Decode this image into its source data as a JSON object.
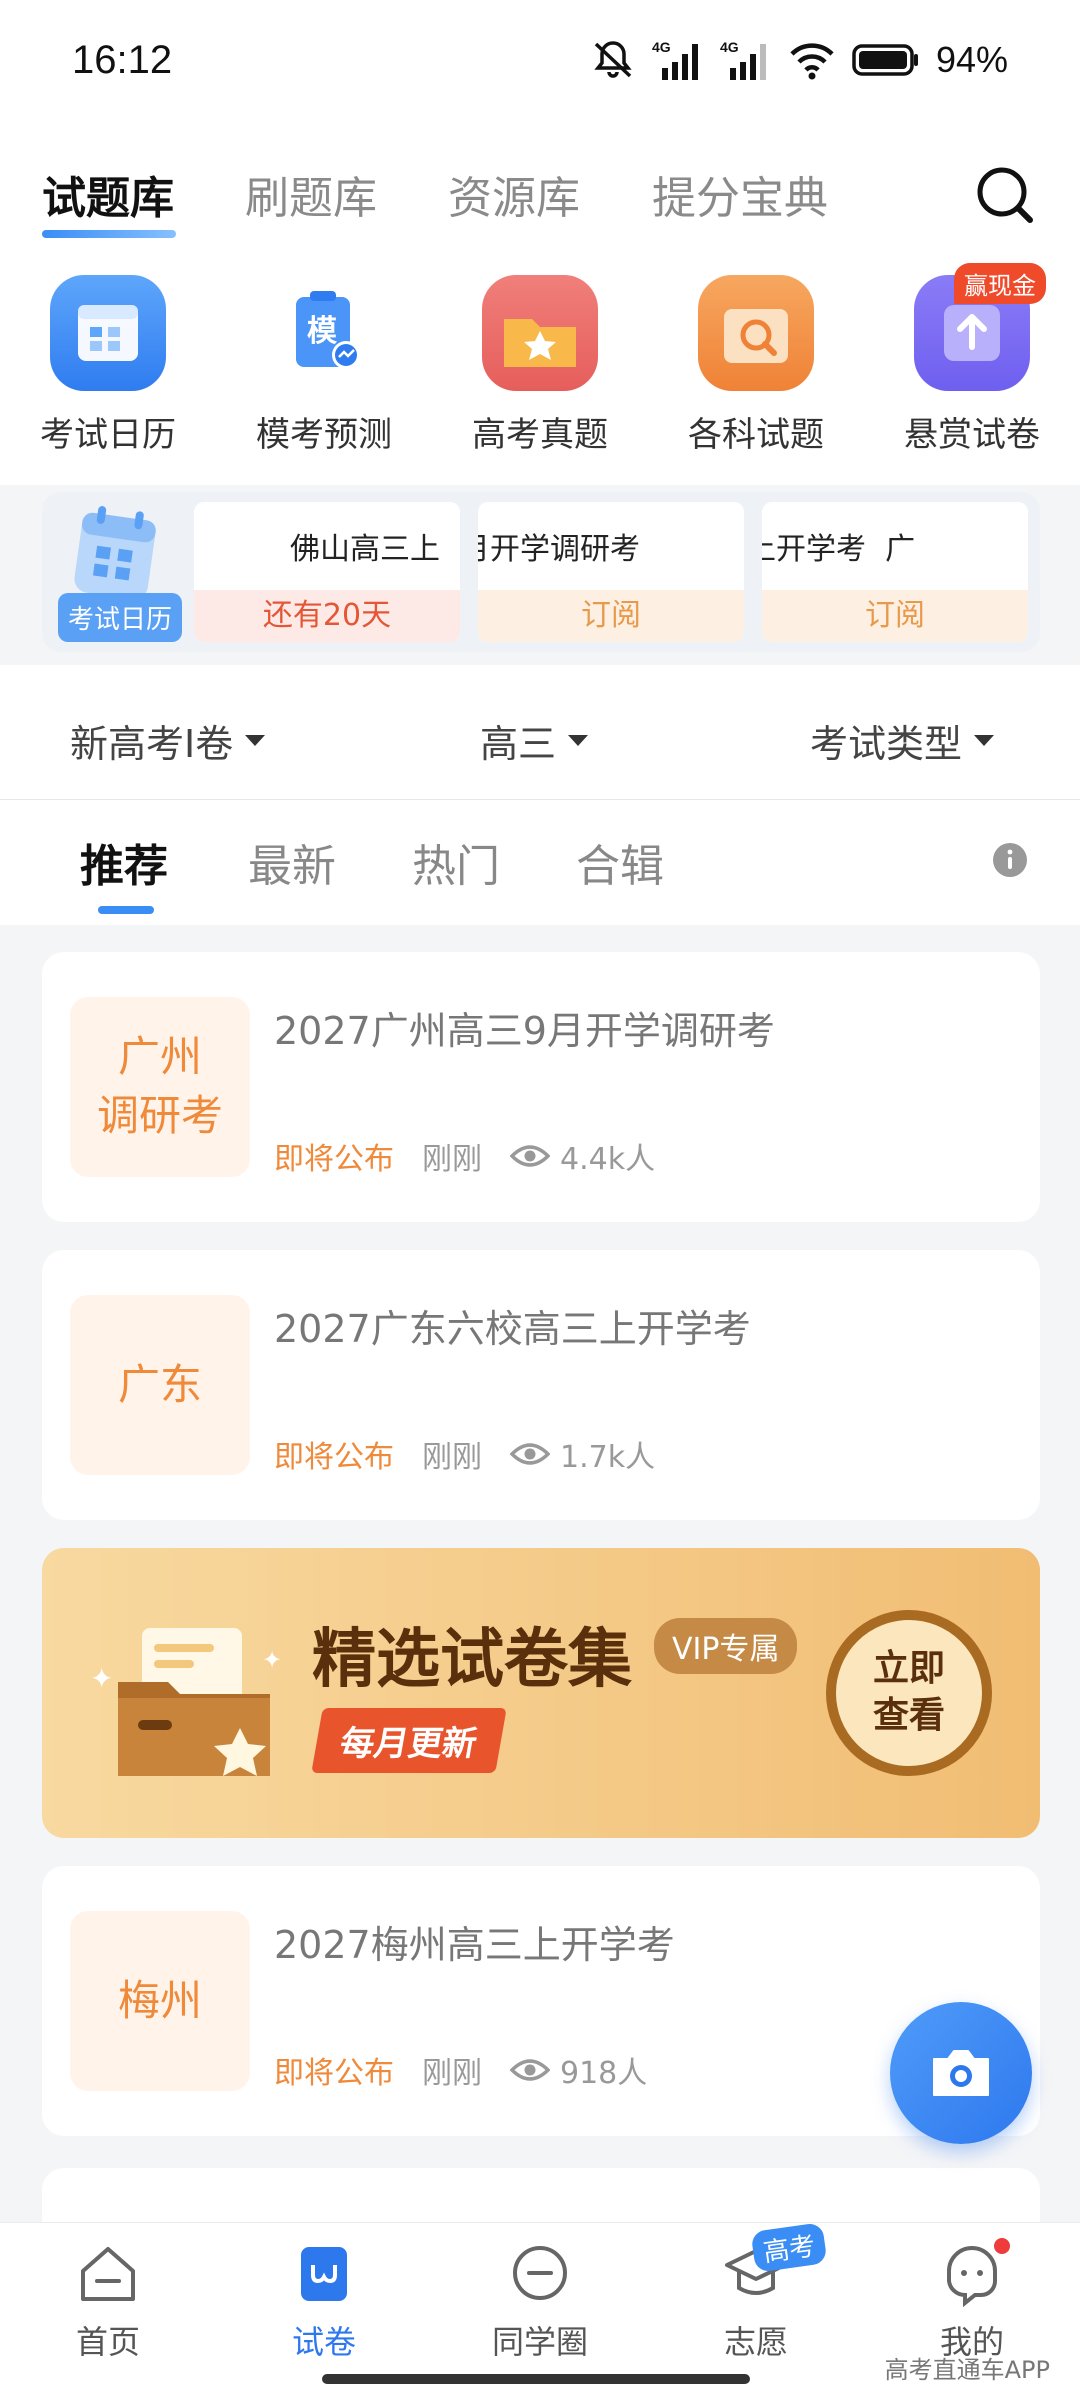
{
  "status_bar": {
    "time": "16:12",
    "battery": "94%",
    "network1": "4G",
    "network2": "4G"
  },
  "top_tabs": [
    {
      "label": "试题库",
      "active": true
    },
    {
      "label": "刷题库",
      "active": false
    },
    {
      "label": "资源库",
      "active": false
    },
    {
      "label": "提分宝典",
      "active": false
    }
  ],
  "shortcuts": [
    {
      "label": "考试日历",
      "icon": "calendar-icon"
    },
    {
      "label": "模考预测",
      "icon": "mock-exam-icon",
      "icon_text": "模"
    },
    {
      "label": "高考真题",
      "icon": "star-folder-icon"
    },
    {
      "label": "各科试题",
      "icon": "search-book-icon"
    },
    {
      "label": "悬赏试卷",
      "icon": "upload-icon",
      "badge": "赢现金"
    }
  ],
  "exam_calendar": {
    "label": "考试日历",
    "cards": [
      {
        "title": "佛山高三上",
        "action": "还有20天"
      },
      {
        "title": "月开学调研考",
        "action": "订阅"
      },
      {
        "title": "上开学考  广",
        "action": "订阅"
      }
    ]
  },
  "filters": [
    {
      "label": "新高考Ⅰ卷"
    },
    {
      "label": "高三"
    },
    {
      "label": "考试类型"
    }
  ],
  "sub_tabs": [
    {
      "label": "推荐",
      "active": true
    },
    {
      "label": "最新",
      "active": false
    },
    {
      "label": "热门",
      "active": false
    },
    {
      "label": "合辑",
      "active": false
    }
  ],
  "papers": [
    {
      "tag": "广州\n调研考",
      "title": "2027广州高三9月开学调研考",
      "status": "即将公布",
      "time": "刚刚",
      "views": "4.4k人"
    },
    {
      "tag": "广东",
      "title": "2027广东六校高三上开学考",
      "status": "即将公布",
      "time": "刚刚",
      "views": "1.7k人"
    },
    {
      "tag": "梅州",
      "title": "2027梅州高三上开学考",
      "status": "即将公布",
      "time": "刚刚",
      "views": "918人"
    }
  ],
  "banner": {
    "title": "精选试卷集",
    "vip": "VIP专属",
    "subtitle": "每月更新",
    "button": "立即\n查看"
  },
  "bottom_nav": [
    {
      "label": "首页",
      "icon": "home-icon",
      "active": false
    },
    {
      "label": "试卷",
      "icon": "paper-icon",
      "active": true
    },
    {
      "label": "同学圈",
      "icon": "chat-icon",
      "active": false
    },
    {
      "label": "志愿",
      "icon": "graduation-cap-icon",
      "active": false,
      "badge": "高考"
    },
    {
      "label": "我的",
      "icon": "profile-icon",
      "active": false
    }
  ],
  "watermark": "高考直通车APP",
  "colors": {
    "accent": "#2e78ee",
    "orange": "#ef8a3b",
    "red": "#e45736"
  }
}
